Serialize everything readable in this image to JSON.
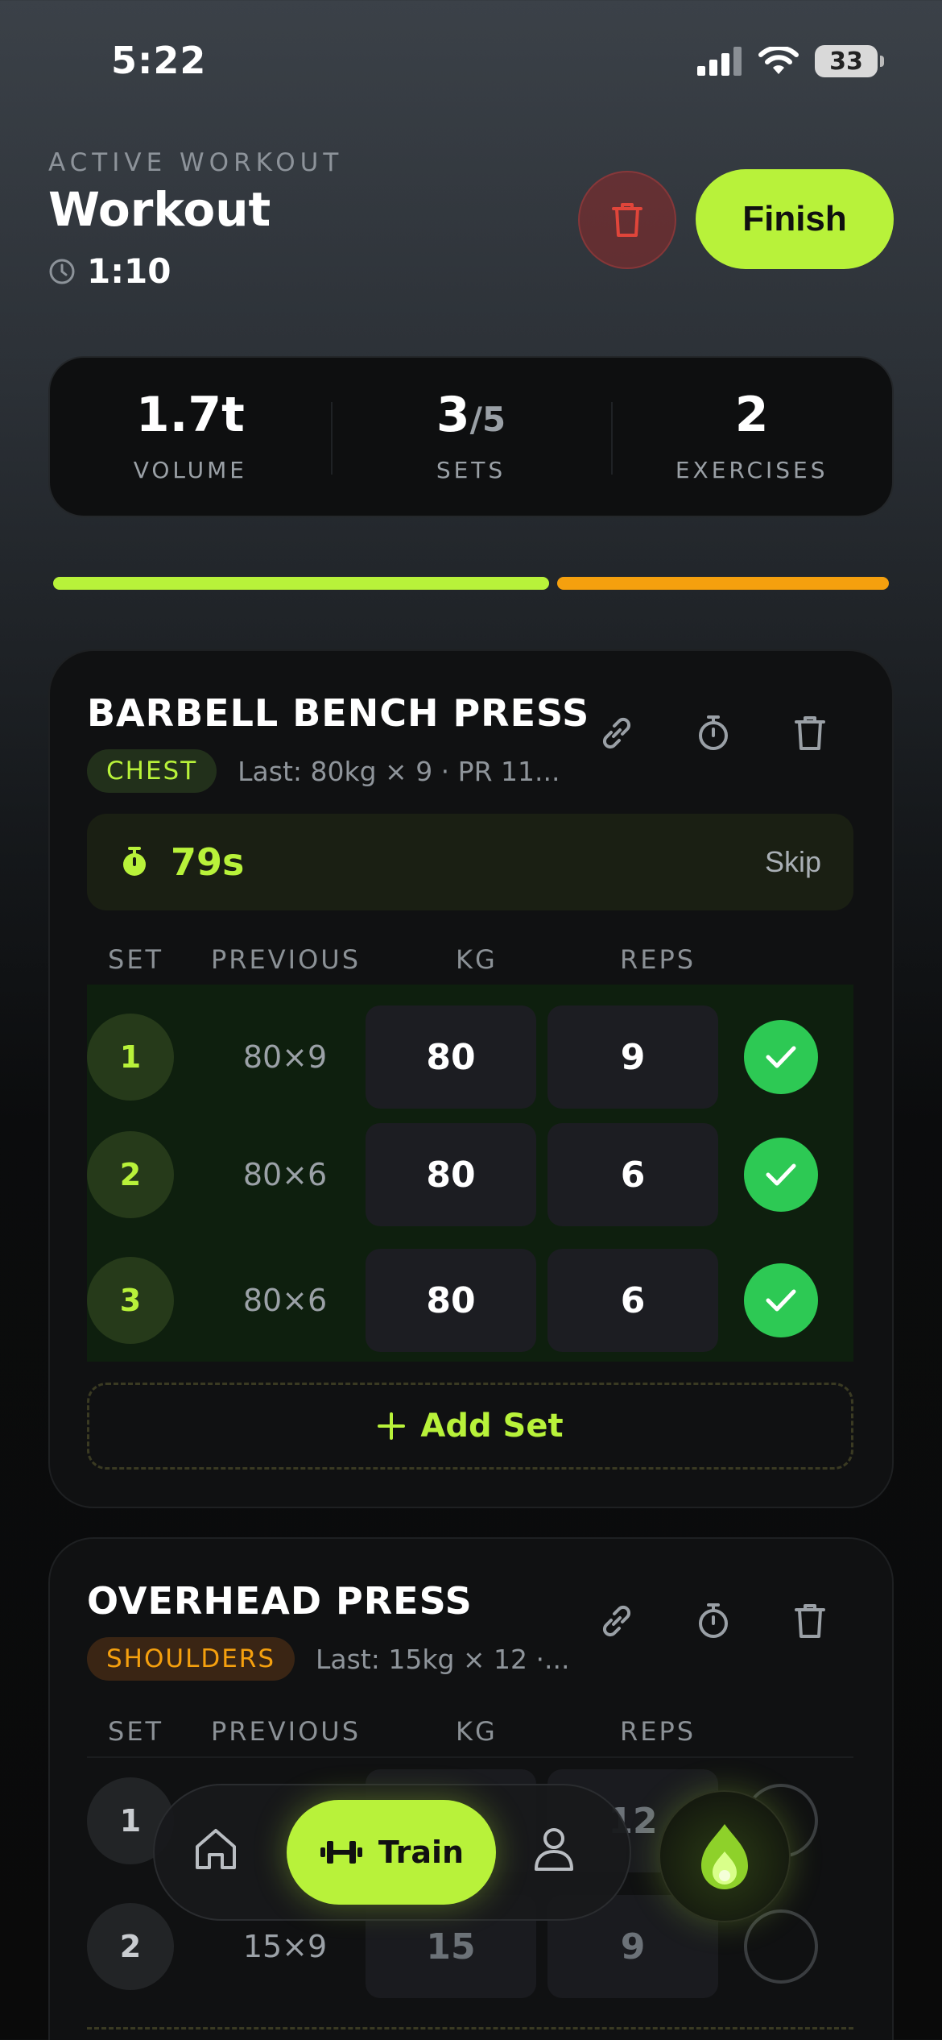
{
  "status": {
    "time": "5:22",
    "battery": "33"
  },
  "header": {
    "eyebrow": "ACTIVE WORKOUT",
    "title": "Workout",
    "elapsed": "1:10",
    "finish_label": "Finish"
  },
  "stats": [
    {
      "value": "1.7t",
      "sub": "",
      "label": "VOLUME"
    },
    {
      "value": "3",
      "sub": "/5",
      "label": "SETS"
    },
    {
      "value": "2",
      "sub": "",
      "label": "EXERCISES"
    }
  ],
  "progress": {
    "exercise1_done_fraction": 1.0,
    "exercise2_done_fraction": 0.0,
    "colors": {
      "done": "#b8f23a",
      "pending": "#f5a00e"
    }
  },
  "table_headers": {
    "set": "SET",
    "previous": "PREVIOUS",
    "kg": "KG",
    "reps": "REPS"
  },
  "exercises": [
    {
      "name": "BARBELL BENCH PRESS",
      "tag": "CHEST",
      "last": "Last: 80kg × 9 · PR 11...",
      "rest": {
        "seconds": "79s",
        "skip_label": "Skip"
      },
      "sets": [
        {
          "num": "1",
          "previous": "80×9",
          "kg": "80",
          "reps": "9",
          "done": true
        },
        {
          "num": "2",
          "previous": "80×6",
          "kg": "80",
          "reps": "6",
          "done": true
        },
        {
          "num": "3",
          "previous": "80×6",
          "kg": "80",
          "reps": "6",
          "done": true
        }
      ],
      "add_set_label": "Add Set"
    },
    {
      "name": "OVERHEAD PRESS",
      "tag": "SHOULDERS",
      "last": "Last: 15kg × 12 ·...",
      "sets": [
        {
          "num": "1",
          "previous": "",
          "kg": "",
          "reps": "12",
          "done": false
        },
        {
          "num": "2",
          "previous": "15×9",
          "kg": "15",
          "reps": "9",
          "done": false
        }
      ]
    }
  ],
  "nav": {
    "train_label": "Train",
    "icons": [
      "home-icon",
      "dumbbell-icon",
      "profile-icon",
      "flame-icon"
    ]
  },
  "colors": {
    "accent": "#b8f23a",
    "orange": "#f5a00e",
    "success": "#2dc954",
    "danger": "#e0453a"
  }
}
